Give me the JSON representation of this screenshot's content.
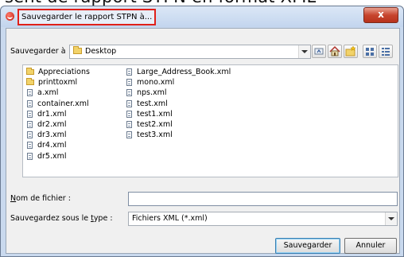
{
  "background_title": "sent de rapport STPN en format XML",
  "dialog": {
    "title": "Sauvegarder le rapport STPN à...",
    "close_label": "x"
  },
  "location": {
    "label": "Sauvegarder à",
    "value": "Desktop"
  },
  "toolbar": {
    "icons": [
      "up-folder-icon",
      "home-icon",
      "new-folder-icon",
      "list-view-icon",
      "details-view-icon"
    ]
  },
  "files": {
    "column1": [
      {
        "name": "Appreciations",
        "type": "folder"
      },
      {
        "name": "printtoxml",
        "type": "folder"
      },
      {
        "name": "a.xml",
        "type": "file"
      },
      {
        "name": "container.xml",
        "type": "file"
      },
      {
        "name": "dr1.xml",
        "type": "file"
      },
      {
        "name": "dr2.xml",
        "type": "file"
      },
      {
        "name": "dr3.xml",
        "type": "file"
      },
      {
        "name": "dr4.xml",
        "type": "file"
      },
      {
        "name": "dr5.xml",
        "type": "file"
      }
    ],
    "column2": [
      {
        "name": "Large_Address_Book.xml",
        "type": "file"
      },
      {
        "name": "mono.xml",
        "type": "file"
      },
      {
        "name": "nps.xml",
        "type": "file"
      },
      {
        "name": "test.xml",
        "type": "file"
      },
      {
        "name": "test1.xml",
        "type": "file"
      },
      {
        "name": "test2.xml",
        "type": "file"
      },
      {
        "name": "test3.xml",
        "type": "file"
      }
    ]
  },
  "filename": {
    "label_ul": "N",
    "label_rest": "om de fichier :",
    "value": ""
  },
  "filetype": {
    "label_pre": "Sauvegardez sous le ",
    "label_ul": "t",
    "label_post": "ype :",
    "value": "Fichiers XML (*.xml)"
  },
  "buttons": {
    "save": "Sauvegarder",
    "cancel": "Annuler"
  }
}
